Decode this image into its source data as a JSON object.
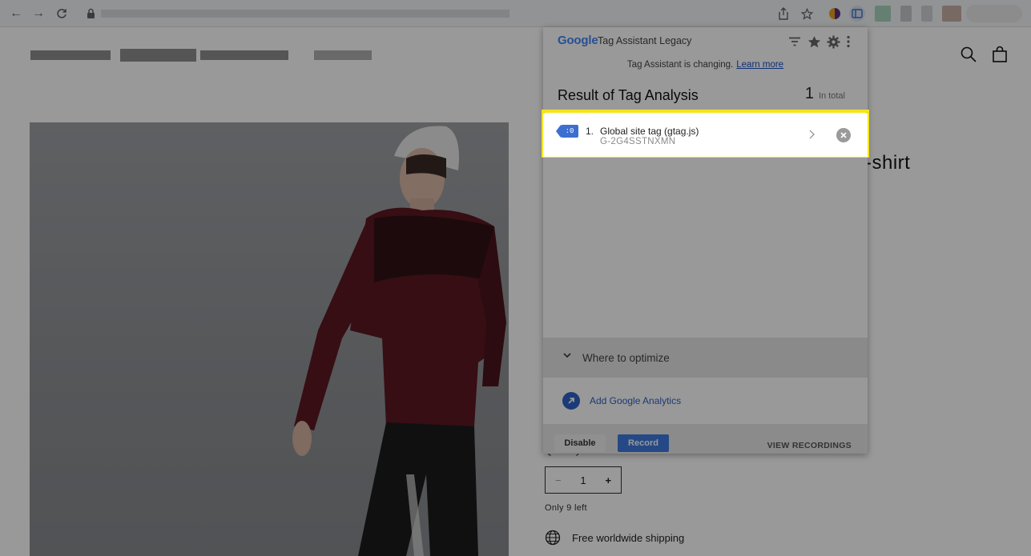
{
  "browser": {
    "nav": {
      "back": "←",
      "forward": "→",
      "reload": "C"
    }
  },
  "store": {
    "product_title_fragment": "-shirt",
    "quantity_label": "Quantity",
    "quantity_minus": "−",
    "quantity_value": "1",
    "quantity_plus": "+",
    "stock": "Only 9 left",
    "shipping": "Free worldwide shipping"
  },
  "tag_assistant": {
    "brand": "Google",
    "app_name": "Tag Assistant Legacy",
    "notice_text": "Tag Assistant is changing.",
    "notice_link": "Learn more",
    "result_title": "Result of Tag Analysis",
    "result_count": "1",
    "result_count_label": "In total",
    "tags": [
      {
        "index": "1.",
        "name": "Global site tag (gtag.js)",
        "id": "G-2G4SSTNXMN",
        "badge": ":0"
      }
    ],
    "optimize_label": "Where to optimize",
    "add_ga_label": "Add Google Analytics",
    "buttons": {
      "disable": "Disable",
      "record": "Record",
      "view_recordings": "VIEW RECORDINGS"
    }
  },
  "colors": {
    "highlight": "#f3e51c",
    "accent": "#3f7be0",
    "tag_badge": "#3c6fd0"
  }
}
